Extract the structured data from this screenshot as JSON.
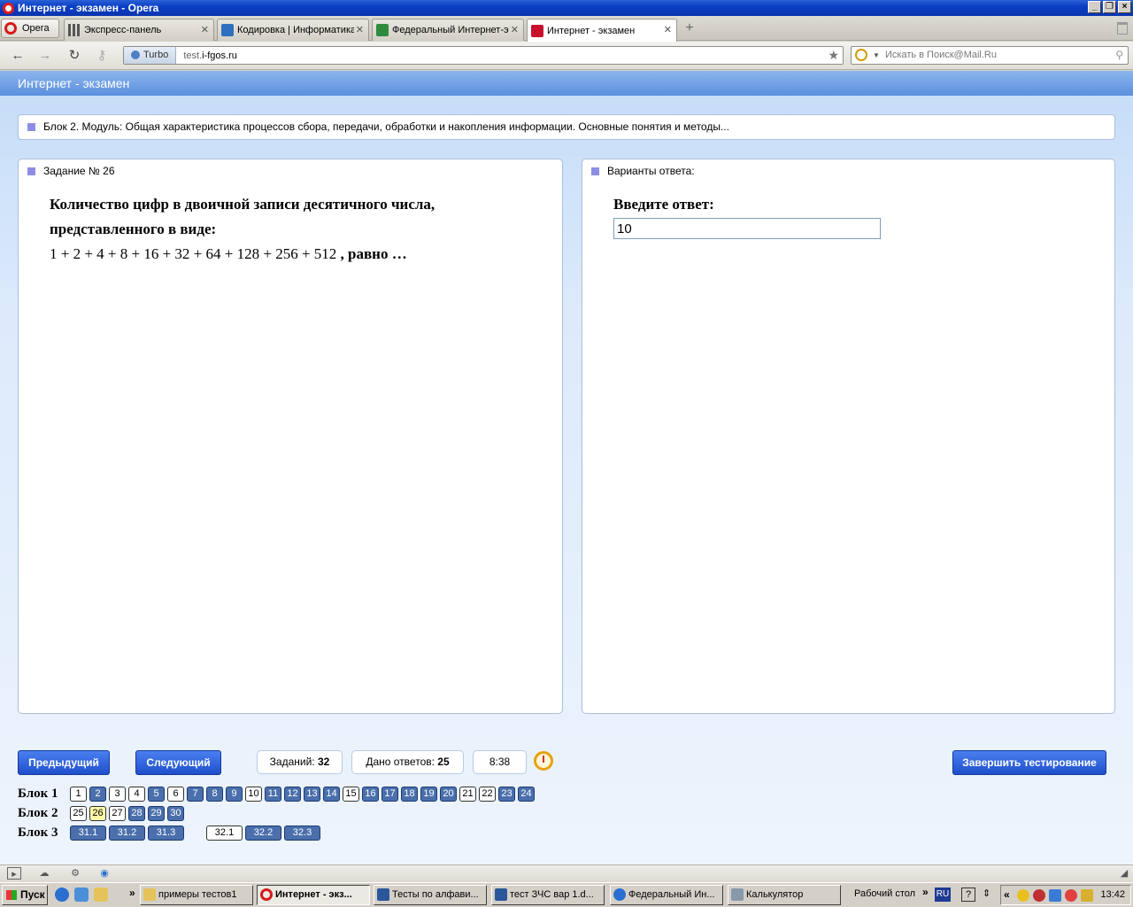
{
  "window": {
    "title": "Интернет - экзамен - Opera"
  },
  "browser": {
    "menu_label": "Opera",
    "tabs": [
      {
        "label": "Экспресс-панель"
      },
      {
        "label": "Кодировка | Информатика"
      },
      {
        "label": "Федеральный Интернет-экзамен"
      },
      {
        "label": "Интернет - экзамен"
      }
    ],
    "turbo_label": "Turbo",
    "url_prefix": "test.",
    "url_domain": "i-fgos.ru",
    "search_placeholder": "Искать в Поиск@Mail.Ru"
  },
  "page": {
    "header": "Интернет - экзамен",
    "block_title": "Блок 2. Модуль: Общая характеристика процессов сбора, передачи, обработки и накопления информации. Основные понятия и методы...",
    "task_title": "Задание № 26",
    "question_text": "Количество цифр в двоичной записи десятичного числа, представленного в виде:",
    "formula": "1 + 2 + 4 + 8 + 16 + 32 + 64 + 128 + 256 + 512",
    "formula_tail": " , равно …",
    "answers_title": "Варианты ответа:",
    "answer_label": "Введите ответ:",
    "answer_value": "10"
  },
  "controls": {
    "prev_label": "Предыдущий",
    "next_label": "Следующий",
    "tasks_label": "Заданий:",
    "tasks_count": "32",
    "answered_label": "Дано ответов:",
    "answered_count": "25",
    "timer": "8:38",
    "finish_label": "Завершить тестирование"
  },
  "blocks": [
    {
      "label": "Блок 1",
      "items": [
        {
          "n": "1",
          "state": "w"
        },
        {
          "n": "2",
          "state": "b"
        },
        {
          "n": "3",
          "state": "w"
        },
        {
          "n": "4",
          "state": "w"
        },
        {
          "n": "5",
          "state": "b"
        },
        {
          "n": "6",
          "state": "w"
        },
        {
          "n": "7",
          "state": "b"
        },
        {
          "n": "8",
          "state": "b"
        },
        {
          "n": "9",
          "state": "b"
        },
        {
          "n": "10",
          "state": "w"
        },
        {
          "n": "11",
          "state": "b"
        },
        {
          "n": "12",
          "state": "b"
        },
        {
          "n": "13",
          "state": "b"
        },
        {
          "n": "14",
          "state": "b"
        },
        {
          "n": "15",
          "state": "w"
        },
        {
          "n": "16",
          "state": "b"
        },
        {
          "n": "17",
          "state": "b"
        },
        {
          "n": "18",
          "state": "b"
        },
        {
          "n": "19",
          "state": "b"
        },
        {
          "n": "20",
          "state": "b"
        },
        {
          "n": "21",
          "state": "w"
        },
        {
          "n": "22",
          "state": "w"
        },
        {
          "n": "23",
          "state": "b"
        },
        {
          "n": "24",
          "state": "b"
        }
      ]
    },
    {
      "label": "Блок 2",
      "items": [
        {
          "n": "25",
          "state": "w"
        },
        {
          "n": "26",
          "state": "y"
        },
        {
          "n": "27",
          "state": "w"
        },
        {
          "n": "28",
          "state": "b"
        },
        {
          "n": "29",
          "state": "b"
        },
        {
          "n": "30",
          "state": "b"
        }
      ]
    },
    {
      "label": "Блок 3",
      "items": [
        {
          "n": "31.1",
          "state": "b"
        },
        {
          "n": "31.2",
          "state": "b"
        },
        {
          "n": "31.3",
          "state": "b"
        },
        {
          "n": "32.1",
          "state": "w"
        },
        {
          "n": "32.2",
          "state": "b"
        },
        {
          "n": "32.3",
          "state": "b"
        }
      ]
    }
  ],
  "taskbar": {
    "start_label": "Пуск",
    "tasks": [
      {
        "label": "примеры тестов1"
      },
      {
        "label": "Интернет - экз..."
      },
      {
        "label": "Тесты по алфави..."
      },
      {
        "label": "тест ЗЧС вар 1.d..."
      },
      {
        "label": "Федеральный Ин..."
      },
      {
        "label": "Калькулятор"
      }
    ],
    "desktop_label": "Рабочий стол",
    "lang": "RU",
    "clock": "13:42"
  },
  "colors": {
    "accent_blue": "#1f4fcc",
    "cell_blue": "#4a6fac",
    "current_cell": "#fff8a8",
    "bullet": "#8e8de6"
  }
}
